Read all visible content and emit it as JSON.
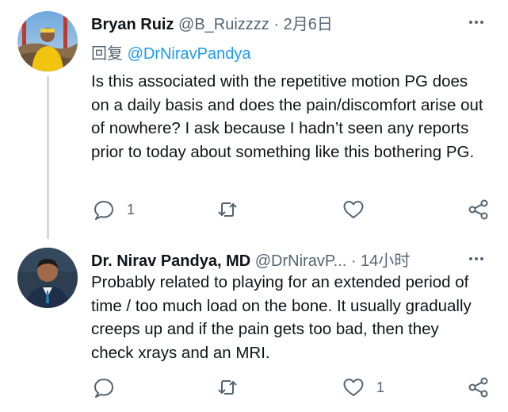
{
  "tweets": [
    {
      "name": "Bryan Ruiz",
      "handle": "@B_Ruizzzz",
      "separator": "·",
      "time": "2月6日",
      "reply_prefix": "回复",
      "reply_to": "@DrNiravPandya",
      "text": "Is this associated with the repetitive motion PG does on a daily basis and does the pain/discomfort arise out of nowhere? I ask because I hadn’t seen any reports prior to today about something like this bothering PG.",
      "reply_count": "1",
      "retweet_count": "",
      "like_count": ""
    },
    {
      "name": "Dr. Nirav Pandya, MD",
      "handle": "@DrNiravP...",
      "separator": "·",
      "time": "14小时",
      "text": "Probably related to playing for an extended period of time / too much load on the bone. It usually gradually creeps up and if the pain gets too bad, then they check xrays and an MRI.",
      "reply_count": "",
      "retweet_count": "",
      "like_count": "1"
    }
  ],
  "icons": {
    "more": "more-dots-icon",
    "reply": "reply-bubble-icon",
    "retweet": "retweet-icon",
    "like": "heart-icon",
    "share": "share-icon"
  },
  "colors": {
    "text": "#0f1419",
    "muted": "#536471",
    "link": "#1d9bf0",
    "thread_line": "#cfd9de"
  }
}
